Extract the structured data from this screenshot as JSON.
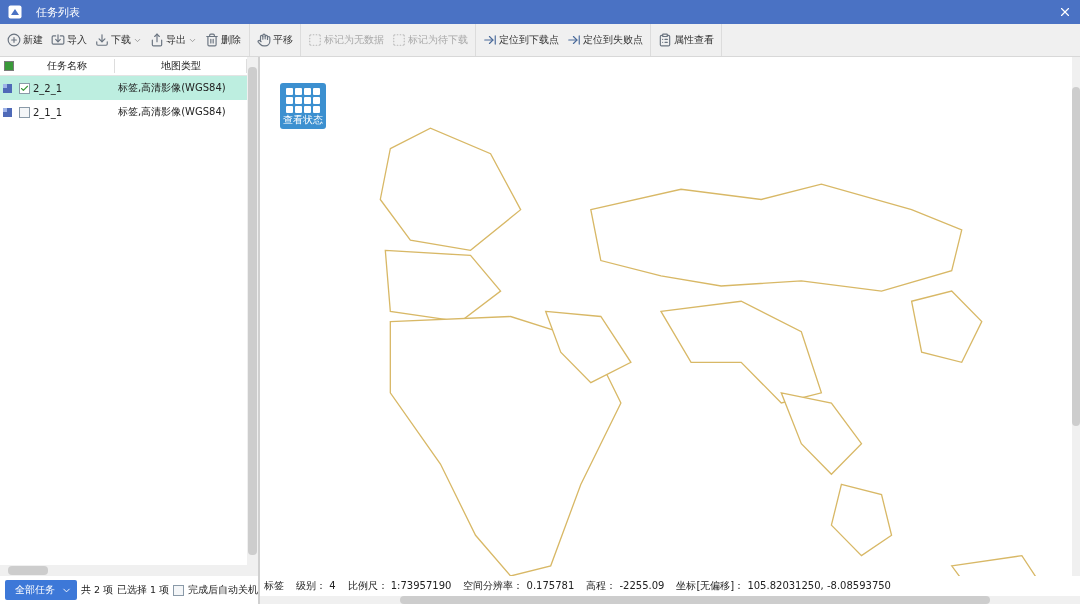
{
  "window": {
    "title": "任务列表"
  },
  "toolbar": {
    "groups": [
      [
        {
          "label": "新建",
          "dropdown": false,
          "disabled": false
        },
        {
          "label": "导入",
          "dropdown": false,
          "disabled": false
        },
        {
          "label": "下载",
          "dropdown": true,
          "disabled": false
        },
        {
          "label": "导出",
          "dropdown": true,
          "disabled": false
        },
        {
          "label": "删除",
          "dropdown": false,
          "disabled": false
        }
      ],
      [
        {
          "label": "平移",
          "dropdown": false,
          "disabled": false
        }
      ],
      [
        {
          "label": "标记为无数据",
          "dropdown": false,
          "disabled": true
        },
        {
          "label": "标记为待下载",
          "dropdown": false,
          "disabled": true
        }
      ],
      [
        {
          "label": "定位到下载点",
          "dropdown": false,
          "disabled": false
        },
        {
          "label": "定位到失败点",
          "dropdown": false,
          "disabled": false
        }
      ],
      [
        {
          "label": "属性查看",
          "dropdown": false,
          "disabled": false
        }
      ]
    ]
  },
  "table": {
    "header_checked": true,
    "columns": [
      "任务名称",
      "地图类型"
    ],
    "rows": [
      {
        "name": "2_2_1",
        "type": "标签,高清影像(WGS84)",
        "selected": true,
        "checked": true
      },
      {
        "name": "2_1_1",
        "type": "标签,高清影像(WGS84)",
        "selected": false,
        "checked": false
      }
    ]
  },
  "footer": {
    "filter_button": "全部任务",
    "total": "共 2 项",
    "selected_count": "已选择 1 项",
    "shutdown": {
      "label": "完成后自动关机",
      "checked": false
    }
  },
  "map": {
    "status_button": "查看状态",
    "kind": "picture"
  },
  "status_bar": [
    {
      "label": "标签"
    },
    {
      "label": "级别：",
      "value": "4"
    },
    {
      "label": "比例尺：",
      "value": "1:73957190"
    },
    {
      "label": "空间分辨率：",
      "value": "0.175781"
    },
    {
      "label": "高程：",
      "value": "-2255.09"
    },
    {
      "label": "坐标[无偏移]：",
      "value": "105.82031250, -8.08593750"
    }
  ]
}
